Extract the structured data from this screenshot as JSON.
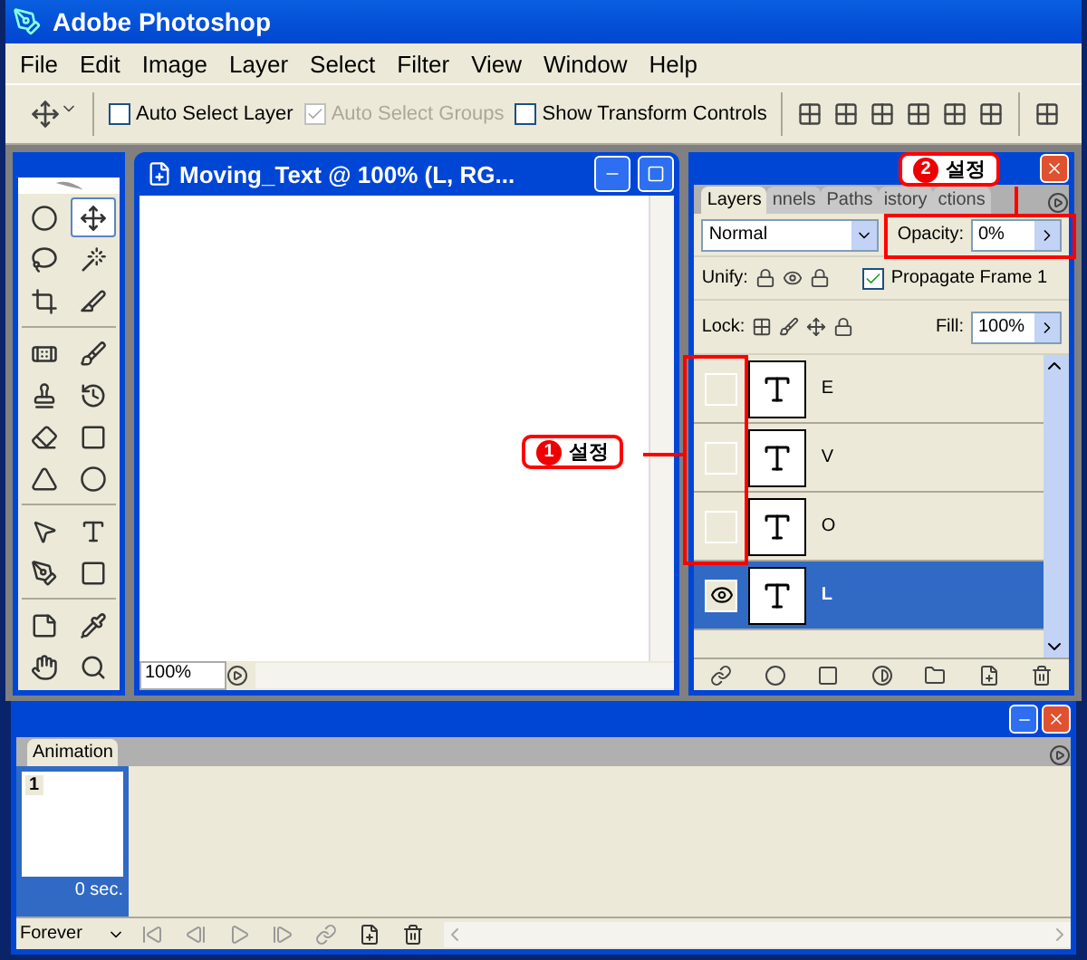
{
  "window": {
    "title": "Adobe Photoshop"
  },
  "menu": [
    "File",
    "Edit",
    "Image",
    "Layer",
    "Select",
    "Filter",
    "View",
    "Window",
    "Help"
  ],
  "options_bar": {
    "checkboxes": [
      {
        "label": "Auto Select Layer",
        "checked": false,
        "disabled": false
      },
      {
        "label": "Auto Select Groups",
        "checked": true,
        "disabled": true
      },
      {
        "label": "Show Transform Controls",
        "checked": false,
        "disabled": false
      }
    ]
  },
  "tools": [
    {
      "kind": "marquee",
      "selected": false
    },
    {
      "kind": "move",
      "selected": true
    },
    {
      "kind": "lasso",
      "selected": false
    },
    {
      "kind": "wand",
      "selected": false
    },
    {
      "kind": "crop",
      "selected": false
    },
    {
      "kind": "slice",
      "selected": false
    },
    {
      "kind": "healing",
      "selected": false
    },
    {
      "kind": "brush",
      "selected": false
    },
    {
      "kind": "stamp",
      "selected": false
    },
    {
      "kind": "history",
      "selected": false
    },
    {
      "kind": "eraser",
      "selected": false
    },
    {
      "kind": "gradient",
      "selected": false
    },
    {
      "kind": "blur",
      "selected": false
    },
    {
      "kind": "burn",
      "selected": false
    },
    {
      "kind": "path_select",
      "selected": false
    },
    {
      "kind": "type",
      "selected": false
    },
    {
      "kind": "pen",
      "selected": false
    },
    {
      "kind": "shape",
      "selected": false
    },
    {
      "kind": "notes",
      "selected": false
    },
    {
      "kind": "eyedropper",
      "selected": false
    },
    {
      "kind": "hand",
      "selected": false
    },
    {
      "kind": "zoom",
      "selected": false
    }
  ],
  "document": {
    "title": "Moving_Text @ 100% (L, RG...",
    "zoom": "100%"
  },
  "layers_panel": {
    "tabs": [
      {
        "label": "Layers",
        "selected": true
      },
      {
        "label": "nnels",
        "selected": false
      },
      {
        "label": "Paths",
        "selected": false
      },
      {
        "label": "istory",
        "selected": false
      },
      {
        "label": "ctions",
        "selected": false
      }
    ],
    "blend_mode": "Normal",
    "opacity_label": "Opacity:",
    "opacity": "0%",
    "unify_label": "Unify:",
    "propagate": {
      "label": "Propagate Frame 1",
      "checked": true
    },
    "lock_label": "Lock:",
    "fill_label": "Fill:",
    "fill": "100%",
    "layers": [
      {
        "name": "E",
        "visible": false,
        "selected": false
      },
      {
        "name": "V",
        "visible": false,
        "selected": false
      },
      {
        "name": "O",
        "visible": false,
        "selected": false
      },
      {
        "name": "L",
        "visible": true,
        "selected": true
      }
    ]
  },
  "animation_panel": {
    "tab": "Animation",
    "frames": [
      {
        "number": "1",
        "delay": "0 sec.",
        "selected": true
      }
    ],
    "loop": "Forever"
  },
  "callouts": [
    {
      "number": "1",
      "label": "설정"
    },
    {
      "number": "2",
      "label": "설정"
    }
  ]
}
